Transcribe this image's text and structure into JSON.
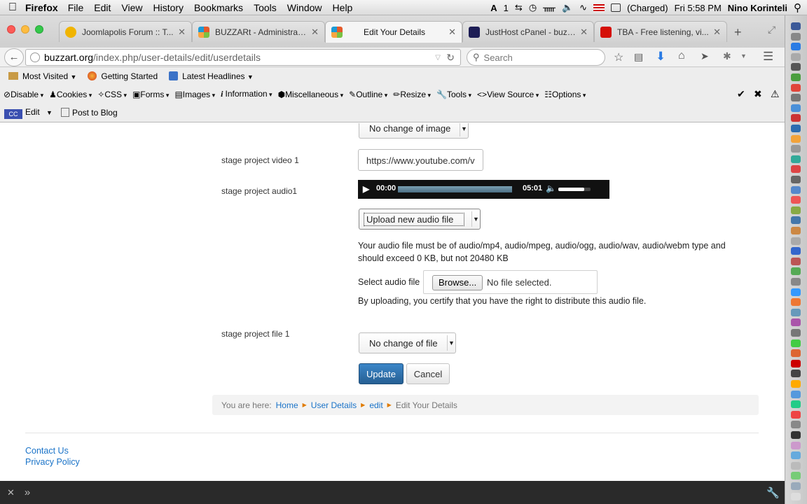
{
  "menubar": {
    "app": "Firefox",
    "items": [
      "File",
      "Edit",
      "View",
      "History",
      "Bookmarks",
      "Tools",
      "Window",
      "Help"
    ],
    "status_number": "1",
    "battery": "(Charged)",
    "clock": "Fri 5:58 PM",
    "user": "Nino Korinteli"
  },
  "tabs": [
    {
      "title": "Joomlapolis Forum :: T...",
      "color": "#f0b400"
    },
    {
      "title": "BUZZARt - Administrat...",
      "color": "#e55a2b"
    },
    {
      "title": "Edit Your Details",
      "color": "#e55a2b"
    },
    {
      "title": "JustHost cPanel - buzz...",
      "color": "#1d1d55"
    },
    {
      "title": "TBA - Free listening, vi...",
      "color": "#d51007"
    }
  ],
  "navbar": {
    "url_domain": "buzzart.org",
    "url_path": "/index.php/user-details/edit/userdetails",
    "search_placeholder": "Search"
  },
  "bookmarks": [
    "Most Visited",
    "Getting Started",
    "Latest Headlines"
  ],
  "devbar": [
    "Disable",
    "Cookies",
    "CSS",
    "Forms",
    "Images",
    "Information",
    "Miscellaneous",
    "Outline",
    "Resize",
    "Tools",
    "View Source",
    "Options"
  ],
  "blogbar": {
    "edit": "Edit",
    "post": "Post to Blog"
  },
  "form": {
    "image_select": "No change of image",
    "video_label": "stage project video 1",
    "video_value": "https://www.youtube.com/v",
    "audio_label": "stage project audio1",
    "player_time": "00:00",
    "player_duration": "05:01",
    "player_progress": 0,
    "player_volume": 0.8,
    "audio_select": "Upload new audio file",
    "audio_info": "Your audio file must be of audio/mp4, audio/mpeg, audio/ogg, audio/wav, audio/webm type and should exceed 0 KB, but not 20480 KB",
    "select_audio_label": "Select audio file",
    "browse": "Browse...",
    "no_file": "No file selected.",
    "certify": "By uploading, you certify that you have the right to distribute this audio file.",
    "file_label": "stage project file 1",
    "file_select": "No change of file",
    "update": "Update",
    "cancel": "Cancel"
  },
  "breadcrumb": {
    "prefix": "You are here:",
    "items": [
      "Home",
      "User Details",
      "edit"
    ],
    "current": "Edit Your Details"
  },
  "footer": {
    "contact": "Contact Us",
    "privacy": "Privacy Policy"
  }
}
